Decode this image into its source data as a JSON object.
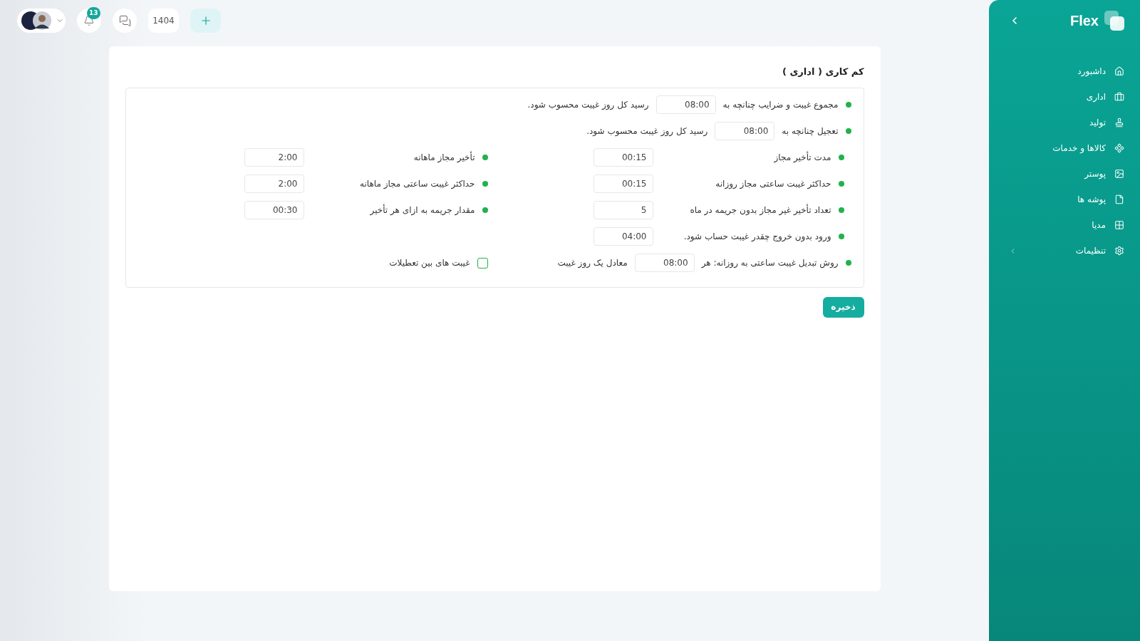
{
  "topbar": {
    "notification_count": "13",
    "year": "1404"
  },
  "sidebar": {
    "brand": "Flex",
    "items": [
      {
        "label": "داشبورد",
        "expandable": false
      },
      {
        "label": "اداری",
        "expandable": false
      },
      {
        "label": "تولید",
        "expandable": false
      },
      {
        "label": "کالاها و خدمات",
        "expandable": false
      },
      {
        "label": "پوستر",
        "expandable": false
      },
      {
        "label": "پوشه ها",
        "expandable": false
      },
      {
        "label": "مدیا",
        "expandable": false
      },
      {
        "label": "تنظیمات",
        "expandable": true
      }
    ]
  },
  "panel": {
    "title": "کم کاری ( اداری )",
    "full_rows": [
      {
        "label": "مجموع غیبت و ضرایب چنانچه به",
        "value": "08:00",
        "suffix": "رسید کل روز غیبت محسوب شود."
      },
      {
        "label": "تعجیل چنانچه به",
        "value": "08:00",
        "suffix": "رسید کل روز غیبت محسوب شود."
      }
    ],
    "right_column": [
      {
        "label": "مدت تأخیر مجاز",
        "value": "00:15"
      },
      {
        "label": "حداکثر غیبت ساعتی مجاز روزانه",
        "value": "00:15"
      },
      {
        "label": "تعداد تأخیر غیر مجاز بدون جریمه در ماه",
        "value": "5"
      },
      {
        "label": "ورود بدون خروج چقدر غیبت حساب شود.",
        "value": "04:00"
      }
    ],
    "left_column": [
      {
        "label": "تأخیر مجاز ماهانه",
        "value": "2:00"
      },
      {
        "label": "حداکثر غیبت ساعتی مجاز ماهانه",
        "value": "2:00"
      },
      {
        "label": "مقدار جریمه به ازای هر تأخیر",
        "value": "00:30"
      }
    ],
    "conversion": {
      "label": "روش تبدیل غیبت ساعتی به روزانه: هر",
      "value": "08:00",
      "suffix": "معادل یک روز غیبت"
    },
    "holiday_checkbox": {
      "label": "غیبت های بین تعطیلات",
      "checked": false
    },
    "save_button": "ذخیره"
  }
}
